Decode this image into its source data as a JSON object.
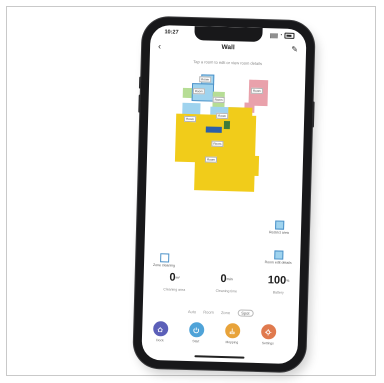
{
  "status_bar": {
    "time": "10:27"
  },
  "header": {
    "title": "Wall",
    "back_icon": "chevron-left-icon",
    "edit_icon": "pencil-icon"
  },
  "hint": "Tap a room to edit or view room details",
  "map": {
    "room_labels": [
      "Room",
      "Room",
      "Room",
      "Room",
      "Room",
      "Room",
      "Room",
      "Room"
    ],
    "side_cards": [
      "Restrict area",
      "Room edit details",
      "Zone cleaning"
    ]
  },
  "stats": [
    {
      "value": "0",
      "unit": "m²",
      "caption": "Cleaning area"
    },
    {
      "value": "0",
      "unit": "min",
      "caption": "Cleaning time"
    },
    {
      "value": "100",
      "unit": "%",
      "caption": "Battery"
    }
  ],
  "tabs": [
    "Auto",
    "Room",
    "Zone",
    "Spot"
  ],
  "active_tab": "Spot",
  "actions": [
    {
      "label": "Dock",
      "icon": "dock-icon",
      "color": "#5b5fb8"
    },
    {
      "label": "Start",
      "icon": "power-icon",
      "color": "#4fa3d8"
    },
    {
      "label": "Mopping",
      "icon": "mop-icon",
      "color": "#e8a33a"
    },
    {
      "label": "Settings",
      "icon": "gear-icon",
      "color": "#e07a4e"
    }
  ],
  "colors": {
    "floor": "#f1cc1a",
    "room_blue": "#9fd3ee",
    "room_green": "#b6dd95",
    "room_red": "#e9a1ab",
    "frame": "#18181a"
  }
}
